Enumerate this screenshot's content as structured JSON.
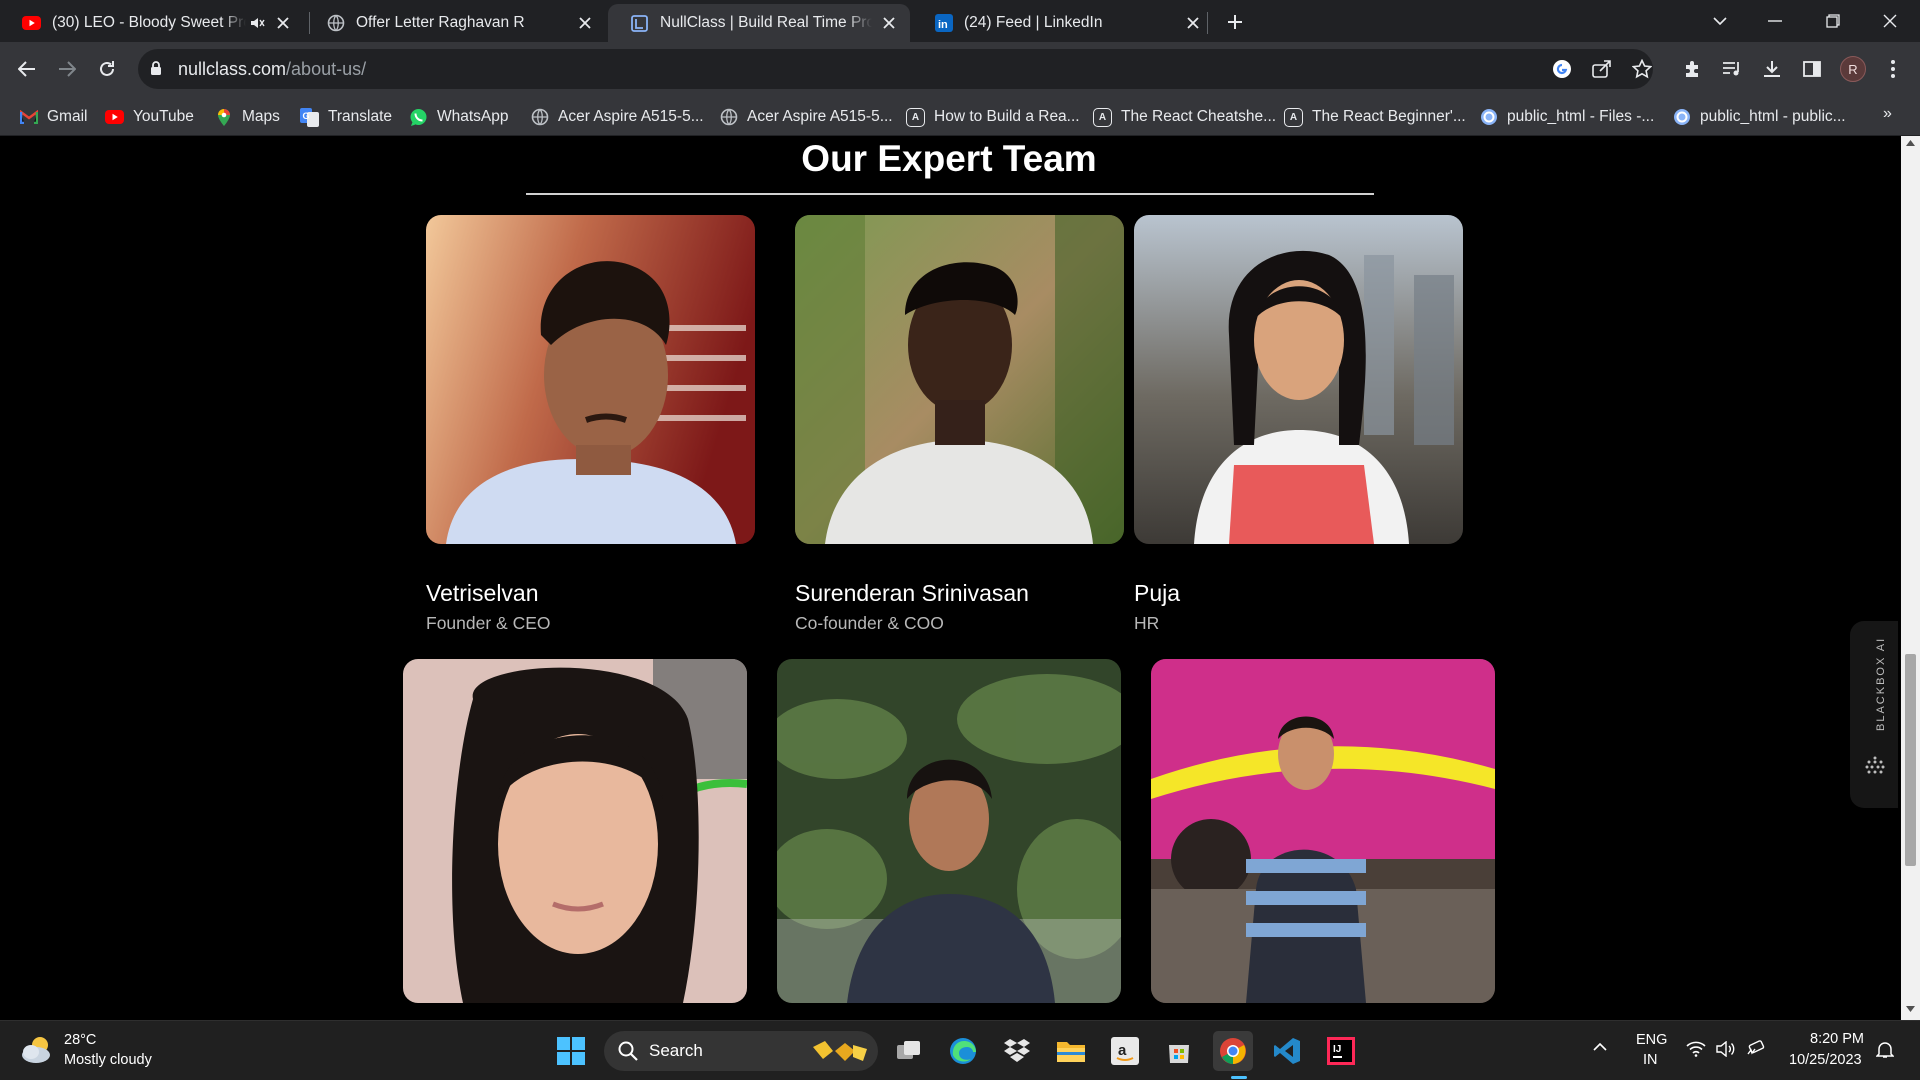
{
  "browser": {
    "tabs": [
      {
        "title": "(30) LEO - Bloody Sweet Pro",
        "favicon": "youtube-icon",
        "audio": true,
        "active": false
      },
      {
        "title": "Offer Letter Raghavan R",
        "favicon": "globe-icon",
        "active": false
      },
      {
        "title": "NullClass | Build Real Time Proje",
        "favicon": "nullclass-icon",
        "active": true
      },
      {
        "title": "(24) Feed | LinkedIn",
        "favicon": "linkedin-icon",
        "active": false
      }
    ],
    "url_host": "nullclass.com",
    "url_path": "/about-us/",
    "profile_initial": "R",
    "bookmarks": [
      {
        "label": "Gmail",
        "icon": "gmail-icon"
      },
      {
        "label": "YouTube",
        "icon": "youtube-icon"
      },
      {
        "label": "Maps",
        "icon": "maps-icon"
      },
      {
        "label": "Translate",
        "icon": "translate-icon"
      },
      {
        "label": "WhatsApp",
        "icon": "whatsapp-icon"
      },
      {
        "label": "Acer Aspire A515-5...",
        "icon": "globe-icon"
      },
      {
        "label": "Acer Aspire A515-5...",
        "icon": "globe-icon"
      },
      {
        "label": "How to Build a Rea...",
        "icon": "react-icon"
      },
      {
        "label": "The React Cheatshe...",
        "icon": "react-icon"
      },
      {
        "label": "The React Beginner'...",
        "icon": "react-icon"
      },
      {
        "label": "public_html - Files -...",
        "icon": "cpanel-icon"
      },
      {
        "label": "public_html - public...",
        "icon": "cpanel-icon"
      }
    ],
    "bookmarks_overflow": "»"
  },
  "page": {
    "heading": "Our Expert Team",
    "members": [
      {
        "name": "Vetriselvan",
        "role": "Founder & CEO"
      },
      {
        "name": "Surenderan Srinivasan",
        "role": "Co-founder & COO"
      },
      {
        "name": "Puja",
        "role": "HR"
      },
      {
        "name": "",
        "role": ""
      },
      {
        "name": "",
        "role": ""
      },
      {
        "name": "",
        "role": ""
      }
    ],
    "sidebar_widget": "BLACKBOX AI"
  },
  "taskbar": {
    "weather_temp": "28°C",
    "weather_condition": "Mostly cloudy",
    "search_label": "Search",
    "language": "ENG",
    "region": "IN",
    "time": "8:20 PM",
    "date": "10/25/2023"
  }
}
